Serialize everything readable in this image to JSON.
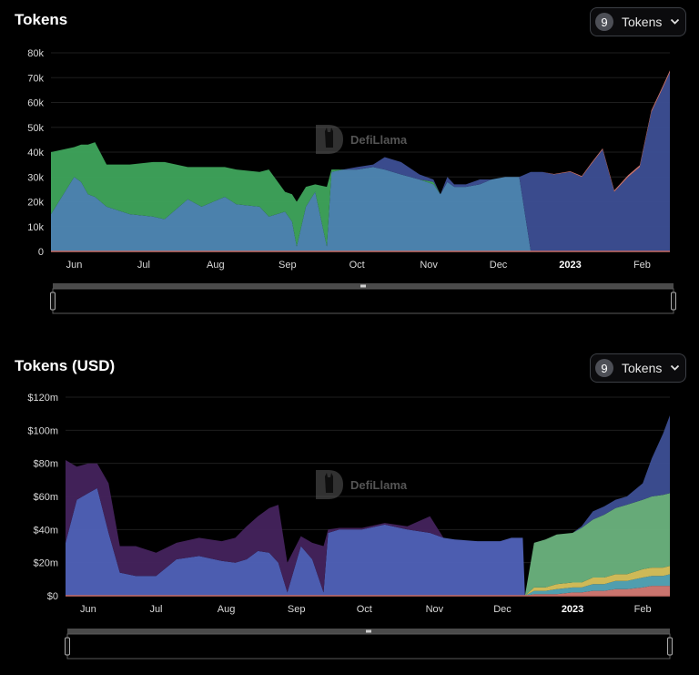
{
  "panels": [
    {
      "title": "Tokens",
      "selector": {
        "count": "9",
        "label": "Tokens"
      },
      "watermark": "DefiLlama"
    },
    {
      "title": "Tokens (USD)",
      "selector": {
        "count": "9",
        "label": "Tokens"
      },
      "watermark": "DefiLlama"
    }
  ],
  "colors": {
    "background": "#000000",
    "grid": "#1e1e1e",
    "text": "#d9d9d9",
    "green": "#3fa55c",
    "steel_blue": "#4f88b5",
    "navy_blue": "#3d4f95",
    "purple": "#45235d",
    "periwinkle": "#5062b9",
    "light_green": "#6bb37e",
    "yellow": "#d9c35c",
    "teal": "#54a6b8",
    "salmon": "#d47a74"
  },
  "chart_data": [
    {
      "type": "area",
      "title": "Tokens",
      "stacked": true,
      "x": [
        "2022-05-22",
        "2022-06-01",
        "2022-06-04",
        "2022-06-07",
        "2022-06-10",
        "2022-06-15",
        "2022-06-25",
        "2022-07-05",
        "2022-07-10",
        "2022-07-20",
        "2022-07-26",
        "2022-08-05",
        "2022-08-10",
        "2022-08-20",
        "2022-08-24",
        "2022-08-31",
        "2022-09-03",
        "2022-09-05",
        "2022-09-09",
        "2022-09-13",
        "2022-09-18",
        "2022-09-20",
        "2022-09-25",
        "2022-10-01",
        "2022-10-08",
        "2022-10-13",
        "2022-10-20",
        "2022-10-28",
        "2022-11-03",
        "2022-11-06",
        "2022-11-09",
        "2022-11-12",
        "2022-11-17",
        "2022-11-23",
        "2022-11-28",
        "2022-12-04",
        "2022-12-10",
        "2022-12-15",
        "2022-12-20",
        "2022-12-25",
        "2023-01-01",
        "2023-01-06",
        "2023-01-10",
        "2023-01-15",
        "2023-01-20",
        "2023-01-26",
        "2023-01-31",
        "2023-02-05",
        "2023-02-10",
        "2023-02-13"
      ],
      "series": [
        {
          "values": [
            15,
            30,
            28,
            23,
            22,
            18,
            15,
            14,
            13,
            21,
            18,
            22,
            19,
            18,
            14,
            16,
            12,
            2,
            18,
            24,
            2,
            32,
            33,
            33,
            34,
            33,
            31,
            29,
            27,
            23,
            28,
            26,
            26,
            27,
            29,
            30,
            30,
            0,
            0,
            0,
            0,
            0,
            0,
            0,
            0,
            0,
            0,
            0,
            0,
            0
          ]
        },
        {
          "values": [
            25,
            12,
            15,
            20,
            22,
            17,
            20,
            22,
            23,
            13,
            16,
            12,
            14,
            14,
            19,
            8,
            11,
            18,
            8,
            3,
            24,
            1,
            0,
            0,
            0,
            0,
            0,
            0,
            1,
            0,
            0,
            0,
            0,
            0,
            0,
            0,
            0,
            0,
            0,
            0,
            0,
            0,
            0,
            0,
            0,
            0,
            0,
            0,
            0,
            0
          ]
        },
        {
          "values": [
            0,
            0,
            0,
            0,
            0,
            0,
            0,
            0,
            0,
            0,
            0,
            0,
            0,
            0,
            0,
            0,
            0,
            0,
            0,
            0,
            0,
            0,
            0,
            1,
            1,
            5,
            5,
            2,
            1,
            0,
            2,
            1,
            1,
            2,
            0,
            0,
            0,
            32,
            32,
            31,
            32,
            30,
            35,
            41,
            24,
            30,
            34,
            56,
            66,
            72
          ]
        },
        {
          "values": [
            0,
            0,
            0,
            0,
            0,
            0,
            0,
            0,
            0,
            0,
            0,
            0,
            0,
            0,
            0,
            0,
            0,
            0,
            0,
            0,
            0,
            0,
            0,
            0,
            0,
            0,
            0,
            0,
            0,
            0,
            0,
            0,
            0,
            0,
            0,
            0,
            0,
            0,
            0,
            0.2,
            0.3,
            0.4,
            0.5,
            0.5,
            0.6,
            0.7,
            0.7,
            0.8,
            0.8,
            0.9
          ]
        }
      ],
      "ylim": [
        0,
        80000
      ],
      "y_ticks": [
        0,
        10000,
        20000,
        30000,
        40000,
        50000,
        60000,
        70000,
        80000
      ],
      "y_tick_labels": [
        "0",
        "10k",
        "20k",
        "30k",
        "40k",
        "50k",
        "60k",
        "70k",
        "80k"
      ],
      "x_ticks": [
        {
          "label": "Jun",
          "date": "2022-06-01"
        },
        {
          "label": "Jul",
          "date": "2022-07-01"
        },
        {
          "label": "Aug",
          "date": "2022-08-01"
        },
        {
          "label": "Sep",
          "date": "2022-09-01"
        },
        {
          "label": "Oct",
          "date": "2022-10-01"
        },
        {
          "label": "Nov",
          "date": "2022-11-01"
        },
        {
          "label": "Dec",
          "date": "2022-12-01"
        },
        {
          "label": "2023",
          "date": "2023-01-01",
          "bold": true
        },
        {
          "label": "Feb",
          "date": "2023-02-01"
        }
      ],
      "grid": true,
      "legend": "none"
    },
    {
      "type": "area",
      "title": "Tokens (USD)",
      "stacked": true,
      "x": [
        "2022-05-22",
        "2022-05-27",
        "2022-06-01",
        "2022-06-05",
        "2022-06-10",
        "2022-06-15",
        "2022-06-22",
        "2022-07-01",
        "2022-07-10",
        "2022-07-20",
        "2022-07-30",
        "2022-08-05",
        "2022-08-10",
        "2022-08-15",
        "2022-08-20",
        "2022-08-24",
        "2022-08-28",
        "2022-09-03",
        "2022-09-08",
        "2022-09-13",
        "2022-09-15",
        "2022-09-20",
        "2022-09-30",
        "2022-10-10",
        "2022-10-20",
        "2022-10-30",
        "2022-11-05",
        "2022-11-10",
        "2022-11-20",
        "2022-11-30",
        "2022-12-05",
        "2022-12-10",
        "2022-12-11",
        "2022-12-15",
        "2022-12-20",
        "2022-12-25",
        "2023-01-01",
        "2023-01-05",
        "2023-01-10",
        "2023-01-15",
        "2023-01-20",
        "2023-01-25",
        "2023-02-01",
        "2023-02-05",
        "2023-02-10",
        "2023-02-13"
      ],
      "series": [
        {
          "values": [
            32,
            58,
            62,
            65,
            38,
            14,
            12,
            12,
            22,
            24,
            21,
            20,
            22,
            27,
            26,
            20,
            2,
            30,
            22,
            2,
            38,
            40,
            40,
            43,
            40,
            38,
            35,
            34,
            33,
            33,
            35,
            35,
            0,
            0,
            0,
            0,
            0,
            0,
            0,
            0,
            0,
            0,
            0,
            0,
            0,
            0
          ]
        },
        {
          "values": [
            50,
            20,
            18,
            15,
            30,
            16,
            18,
            14,
            10,
            11,
            12,
            15,
            20,
            21,
            27,
            35,
            18,
            6,
            10,
            28,
            2,
            1,
            1,
            1,
            2,
            10,
            0,
            0,
            0,
            0,
            0,
            0,
            0,
            0,
            0,
            0,
            0,
            0,
            0,
            0,
            0,
            0,
            0,
            0,
            0,
            0
          ]
        },
        {
          "values": [
            0,
            0,
            0,
            0,
            0,
            0,
            0,
            0,
            0,
            0,
            0,
            0,
            0,
            0,
            0,
            0,
            0,
            0,
            0,
            0,
            0,
            0,
            0,
            0,
            0,
            0,
            0,
            0,
            0,
            0,
            0,
            0,
            0,
            1,
            1,
            1,
            2,
            2,
            3,
            3,
            4,
            4,
            5,
            6,
            6,
            6
          ]
        },
        {
          "values": [
            0,
            0,
            0,
            0,
            0,
            0,
            0,
            0,
            0,
            0,
            0,
            0,
            0,
            0,
            0,
            0,
            0,
            0,
            0,
            0,
            0,
            0,
            0,
            0,
            0,
            0,
            0,
            0,
            0,
            0,
            0,
            0,
            0,
            2,
            2,
            3,
            3,
            3,
            4,
            4,
            5,
            5,
            6,
            6,
            6,
            7
          ]
        },
        {
          "values": [
            0,
            0,
            0,
            0,
            0,
            0,
            0,
            0,
            0,
            0,
            0,
            0,
            0,
            0,
            0,
            0,
            0,
            0,
            0,
            0,
            0,
            0,
            0,
            0,
            0,
            0,
            0,
            0,
            0,
            0,
            0,
            0,
            0,
            2,
            2,
            3,
            3,
            3,
            4,
            4,
            4,
            4,
            5,
            5,
            5,
            5
          ]
        },
        {
          "values": [
            0,
            0,
            0,
            0,
            0,
            0,
            0,
            0,
            0,
            0,
            0,
            0,
            0,
            0,
            0,
            0,
            0,
            0,
            0,
            0,
            0,
            0,
            0,
            0,
            0,
            0,
            0,
            0,
            0,
            0,
            0,
            0,
            0,
            27,
            29,
            30,
            30,
            33,
            35,
            38,
            40,
            42,
            42,
            43,
            44,
            44
          ]
        },
        {
          "values": [
            0,
            0,
            0,
            0,
            0,
            0,
            0,
            0,
            0,
            0,
            0,
            0,
            0,
            0,
            0,
            0,
            0,
            0,
            0,
            0,
            0,
            0,
            0,
            0,
            0,
            0,
            0,
            0,
            0,
            0,
            0,
            0,
            0,
            0,
            0,
            0,
            0,
            1,
            5,
            5,
            5,
            5,
            10,
            23,
            37,
            47
          ]
        }
      ],
      "ylim": [
        0,
        120
      ],
      "y_ticks": [
        0,
        20,
        40,
        60,
        80,
        100,
        120
      ],
      "y_tick_labels": [
        "$0",
        "$20m",
        "$40m",
        "$60m",
        "$80m",
        "$100m",
        "$120m"
      ],
      "x_ticks": [
        {
          "label": "Jun",
          "date": "2022-06-01"
        },
        {
          "label": "Jul",
          "date": "2022-07-01"
        },
        {
          "label": "Aug",
          "date": "2022-08-01"
        },
        {
          "label": "Sep",
          "date": "2022-09-01"
        },
        {
          "label": "Oct",
          "date": "2022-10-01"
        },
        {
          "label": "Nov",
          "date": "2022-11-01"
        },
        {
          "label": "Dec",
          "date": "2022-12-01"
        },
        {
          "label": "2023",
          "date": "2023-01-01",
          "bold": true
        },
        {
          "label": "Feb",
          "date": "2023-02-01"
        }
      ],
      "grid": true,
      "legend": "none"
    }
  ]
}
